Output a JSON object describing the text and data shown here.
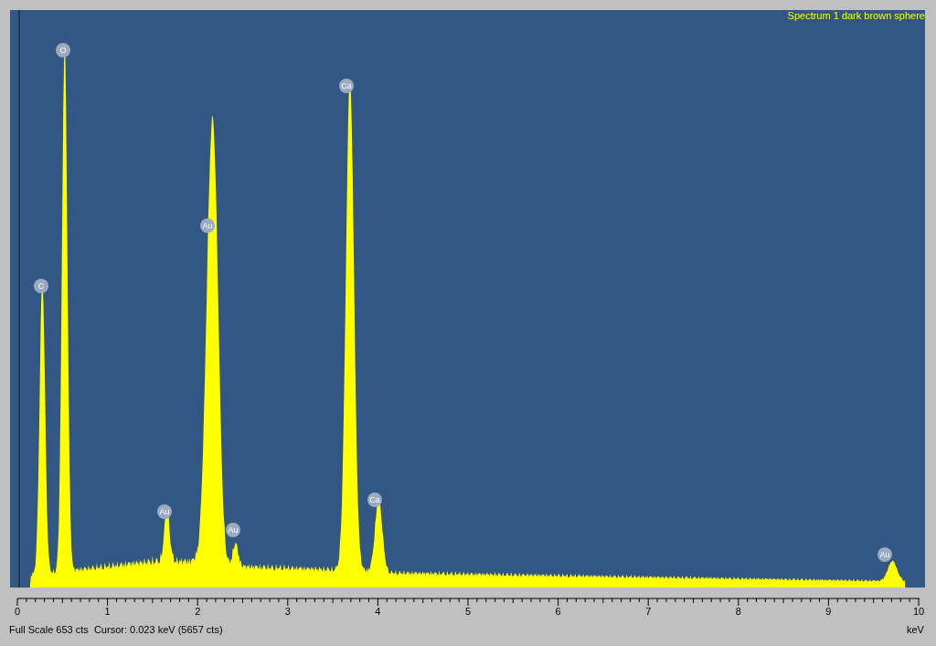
{
  "spectrum": {
    "title": "Spectrum 1 dark brown sphere",
    "peak_labels": [
      "C",
      "O",
      "Au",
      "Au",
      "Au",
      "Ca",
      "Ca",
      "Au"
    ],
    "axis": {
      "ticks": [
        "0",
        "1",
        "2",
        "3",
        "4",
        "5",
        "6",
        "7",
        "8",
        "9",
        "10"
      ],
      "unit": "keV"
    }
  },
  "status_bar": {
    "text": "Full Scale 653 cts  Cursor: 0.023 keV (5657 cts)"
  }
}
